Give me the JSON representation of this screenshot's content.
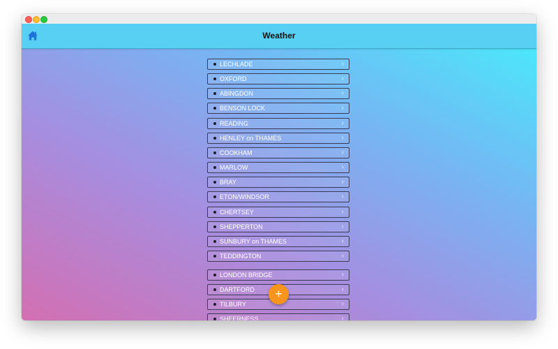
{
  "navbar": {
    "title": "Weather",
    "home_icon": "home-icon",
    "background": "#57d0f3"
  },
  "locations": [
    {
      "label": "LECHLADE"
    },
    {
      "label": "OXFORD"
    },
    {
      "label": "ABINGDON"
    },
    {
      "label": "BENSON LOCK"
    },
    {
      "label": "READING"
    },
    {
      "label": "HENLEY on THAMES"
    },
    {
      "label": "COOKHAM"
    },
    {
      "label": "MARLOW"
    },
    {
      "label": "BRAY"
    },
    {
      "label": "ETON/WINDSOR"
    },
    {
      "label": "CHERTSEY"
    },
    {
      "label": "SHEPPERTON"
    },
    {
      "label": "SUNBURY on THAMES"
    },
    {
      "label": "TEDDINGTON"
    },
    {
      "label": "LONDON BRIDGE"
    },
    {
      "label": "DARTFORD"
    },
    {
      "label": "TILBURY"
    },
    {
      "label": "SHEERNESS"
    }
  ],
  "list_item_icon": "chevron-right-icon",
  "fab": {
    "icon": "plus-icon",
    "glyph": "+",
    "color": "#f7941d"
  }
}
